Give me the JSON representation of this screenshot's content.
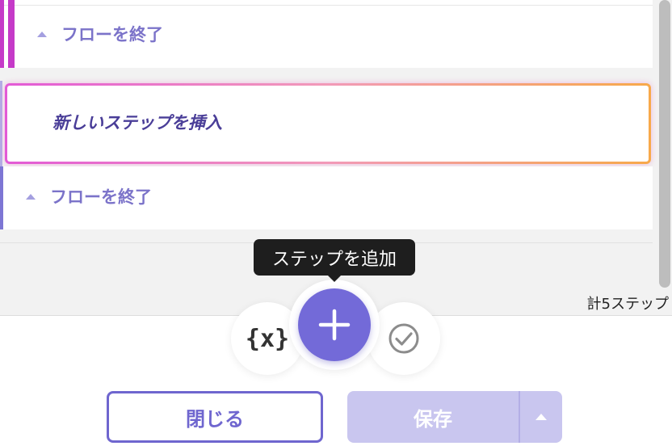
{
  "flow": {
    "end_flow_label_1": "フローを終了",
    "insert_step_label": "新しいステップを挿入",
    "end_flow_label_2": "フローを終了",
    "step_count": "計5ステップ"
  },
  "toolbar": {
    "tooltip": "ステップを追加",
    "variable_label": "{x}"
  },
  "footer": {
    "close_label": "閉じる",
    "save_label": "保存"
  },
  "colors": {
    "accent": "#736ad8",
    "accent_text": "#7b73c9",
    "branch_magenta": "#c53ac8",
    "save_disabled": "#c9c6ef"
  }
}
